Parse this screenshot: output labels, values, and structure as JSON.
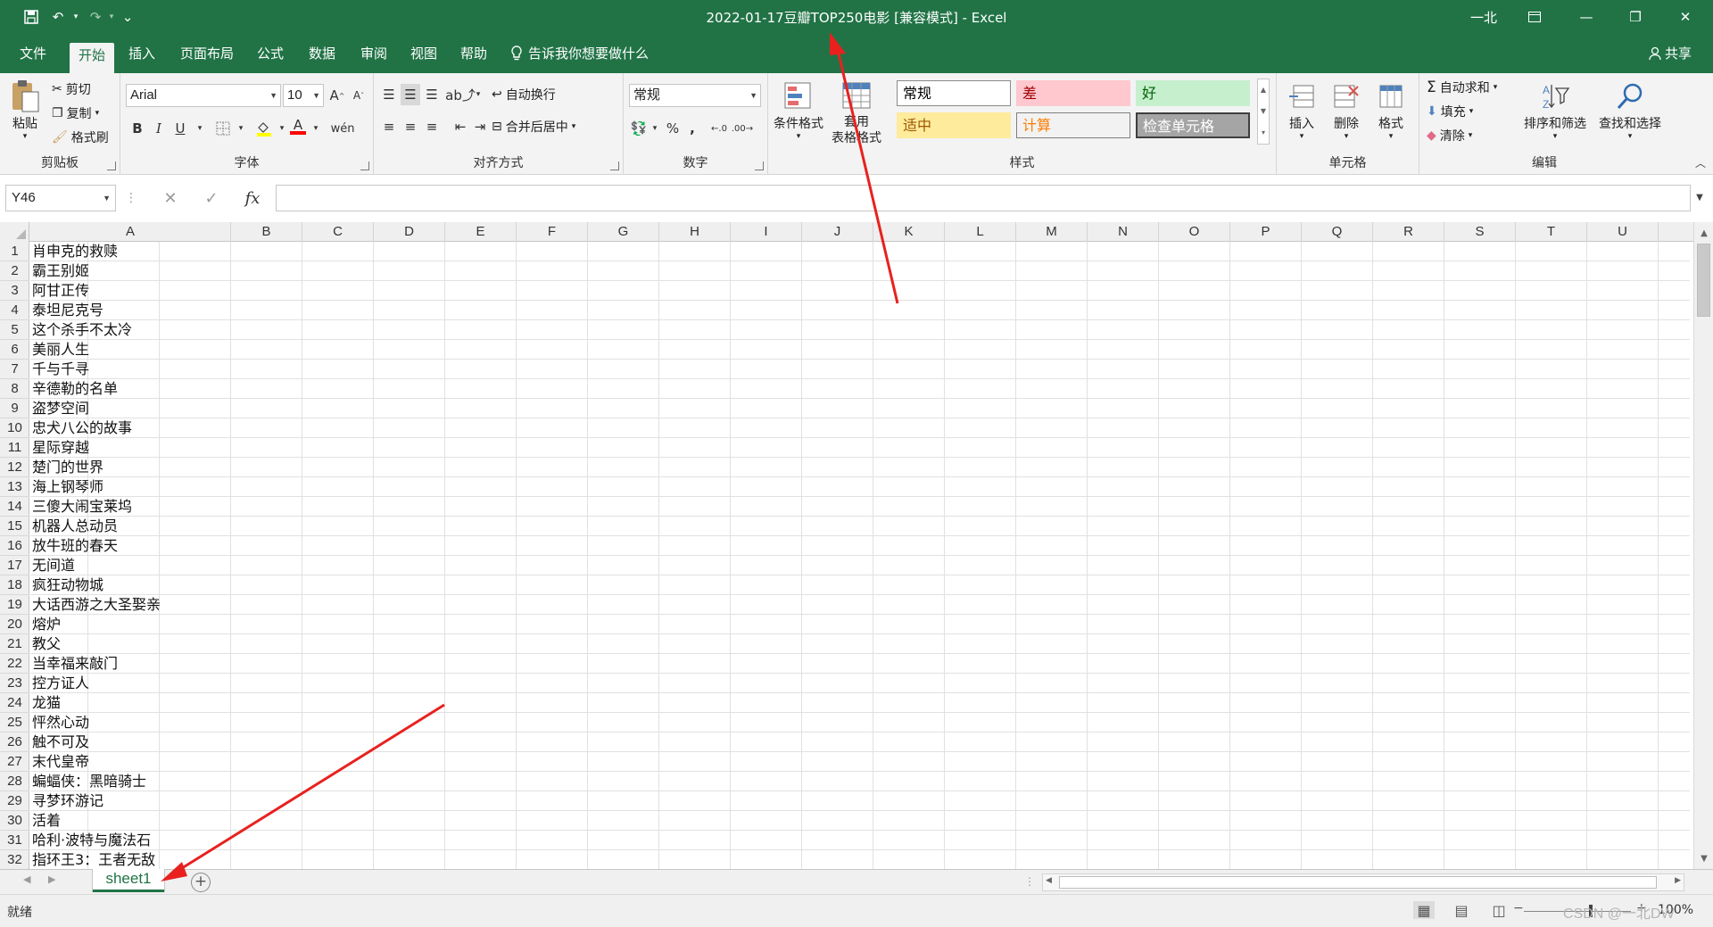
{
  "window": {
    "title": "2022-01-17豆瓣TOP250电影  [兼容模式]  -  Excel",
    "user": "一北",
    "minimize": "—",
    "restore": "❐",
    "close": "✕"
  },
  "quick_access": {
    "save_icon": "save-icon",
    "undo_icon": "undo-icon",
    "redo_icon": "redo-icon",
    "customize": "⌄"
  },
  "ribbon_tabs": [
    "文件",
    "开始",
    "插入",
    "页面布局",
    "公式",
    "数据",
    "审阅",
    "视图",
    "帮助"
  ],
  "active_tab": "开始",
  "tell_me": "告诉我你想要做什么",
  "share": "共享",
  "clipboard": {
    "paste": "粘贴",
    "cut": "剪切",
    "copy": "复制",
    "format_painter": "格式刷",
    "label": "剪贴板"
  },
  "font": {
    "name": "Arial",
    "size": "10",
    "label": "字体",
    "bold": "B",
    "italic": "I",
    "underline": "U",
    "grow": "A",
    "shrink": "A",
    "font_color": "A"
  },
  "alignment": {
    "wrap_text": "自动换行",
    "merge_center": "合并后居中",
    "label": "对齐方式"
  },
  "number": {
    "format": "常规",
    "percent": "%",
    "comma": ",",
    "label": "数字"
  },
  "styles": {
    "conditional": "条件格式",
    "table_line1": "套用",
    "table_line2": "表格格式",
    "label": "样式",
    "cells": [
      {
        "text": "常规",
        "bg": "#ffffff",
        "fg": "#000000",
        "border": "#8a8a8a"
      },
      {
        "text": "差",
        "bg": "#ffc7ce",
        "fg": "#9c0006",
        "border": "#ffc7ce"
      },
      {
        "text": "好",
        "bg": "#c6efce",
        "fg": "#006100",
        "border": "#c6efce"
      },
      {
        "text": "适中",
        "bg": "#ffeb9c",
        "fg": "#9c5700",
        "border": "#ffeb9c"
      },
      {
        "text": "计算",
        "bg": "#f2f2f2",
        "fg": "#fa7d00",
        "border": "#7f7f7f"
      },
      {
        "text": "检查单元格",
        "bg": "#a5a5a5",
        "fg": "#ffffff",
        "border": "#3f3f3f"
      }
    ]
  },
  "cells_group": {
    "insert": "插入",
    "delete": "删除",
    "format": "格式",
    "label": "单元格"
  },
  "editing": {
    "autosum": "自动求和",
    "fill": "填充",
    "clear": "清除",
    "sort_filter": "排序和筛选",
    "find_select": "查找和选择",
    "label": "编辑"
  },
  "formula_bar": {
    "name_box": "Y46",
    "cancel": "✕",
    "enter": "✓",
    "fx": "fx",
    "formula": ""
  },
  "columns": [
    "A",
    "B",
    "C",
    "D",
    "E",
    "F",
    "G",
    "H",
    "I",
    "J",
    "K",
    "L",
    "M",
    "N",
    "O",
    "P",
    "Q",
    "R",
    "S",
    "T",
    "U"
  ],
  "rows": [
    {
      "n": "1",
      "a": "肖申克的救赎"
    },
    {
      "n": "2",
      "a": "霸王别姬"
    },
    {
      "n": "3",
      "a": "阿甘正传"
    },
    {
      "n": "4",
      "a": "泰坦尼克号"
    },
    {
      "n": "5",
      "a": "这个杀手不太冷"
    },
    {
      "n": "6",
      "a": "美丽人生"
    },
    {
      "n": "7",
      "a": "千与千寻"
    },
    {
      "n": "8",
      "a": "辛德勒的名单"
    },
    {
      "n": "9",
      "a": "盗梦空间"
    },
    {
      "n": "10",
      "a": "忠犬八公的故事"
    },
    {
      "n": "11",
      "a": "星际穿越"
    },
    {
      "n": "12",
      "a": "楚门的世界"
    },
    {
      "n": "13",
      "a": "海上钢琴师"
    },
    {
      "n": "14",
      "a": "三傻大闹宝莱坞"
    },
    {
      "n": "15",
      "a": "机器人总动员"
    },
    {
      "n": "16",
      "a": "放牛班的春天"
    },
    {
      "n": "17",
      "a": "无间道"
    },
    {
      "n": "18",
      "a": "疯狂动物城"
    },
    {
      "n": "19",
      "a": "大话西游之大圣娶亲"
    },
    {
      "n": "20",
      "a": "熔炉"
    },
    {
      "n": "21",
      "a": "教父"
    },
    {
      "n": "22",
      "a": "当幸福来敲门"
    },
    {
      "n": "23",
      "a": "控方证人"
    },
    {
      "n": "24",
      "a": "龙猫"
    },
    {
      "n": "25",
      "a": "怦然心动"
    },
    {
      "n": "26",
      "a": "触不可及"
    },
    {
      "n": "27",
      "a": "末代皇帝"
    },
    {
      "n": "28",
      "a": "蝙蝠侠：黑暗骑士"
    },
    {
      "n": "29",
      "a": "寻梦环游记"
    },
    {
      "n": "30",
      "a": "活着"
    },
    {
      "n": "31",
      "a": "哈利·波特与魔法石"
    },
    {
      "n": "32",
      "a": "指环王3：王者无敌"
    }
  ],
  "sheet_tab": "sheet1",
  "add_sheet": "⊕",
  "status": {
    "text": "就绪",
    "zoom": "100%"
  },
  "watermark": "CSDN @一北DW",
  "colors": {
    "excel_green": "#217346",
    "annotation_red": "#e8211f"
  }
}
